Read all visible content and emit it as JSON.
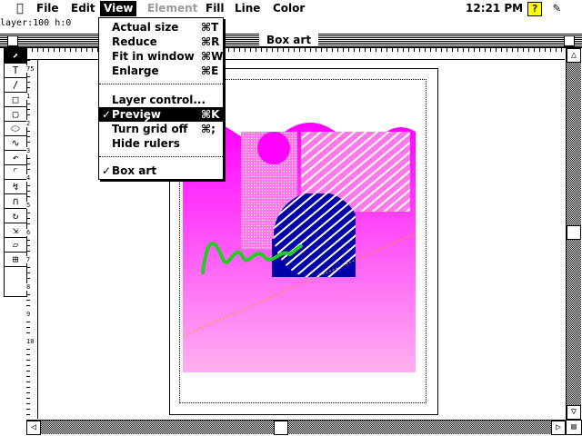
{
  "menubar": {
    "items": [
      "File",
      "Edit",
      "View",
      "Element",
      "Fill",
      "Line",
      "Color"
    ],
    "time": "12:21 PM",
    "apple_icon": "apple-icon",
    "help_icon": "help-icon",
    "app_icon": "pen-icon"
  },
  "status": {
    "text": "layer:100  h:0"
  },
  "window": {
    "title": "Box art"
  },
  "view_menu": {
    "items": [
      {
        "label": "Actual size",
        "shortcut": "⌘T"
      },
      {
        "label": "Reduce",
        "shortcut": "⌘R"
      },
      {
        "label": "Fit in window",
        "shortcut": "⌘W"
      },
      {
        "label": "Enlarge",
        "shortcut": "⌘E"
      },
      {
        "label": "Layer control...",
        "shortcut": ""
      },
      {
        "label": "Preview",
        "shortcut": "⌘K",
        "checked": true
      },
      {
        "label": "Turn grid off",
        "shortcut": "⌘;"
      },
      {
        "label": "Hide rulers",
        "shortcut": ""
      },
      {
        "label": "Box art",
        "shortcut": "",
        "checked": true
      }
    ],
    "highlighted": "Preview"
  },
  "ruler": {
    "vertical_ticks": [
      "75",
      "1",
      "2",
      "3",
      "4",
      "5",
      "6",
      "7",
      "8",
      "9",
      "10"
    ]
  },
  "colors": {
    "magenta": "#ff00ff",
    "blue": "#0000aa",
    "green": "#22cc22",
    "pink": "#ff9ee5"
  }
}
